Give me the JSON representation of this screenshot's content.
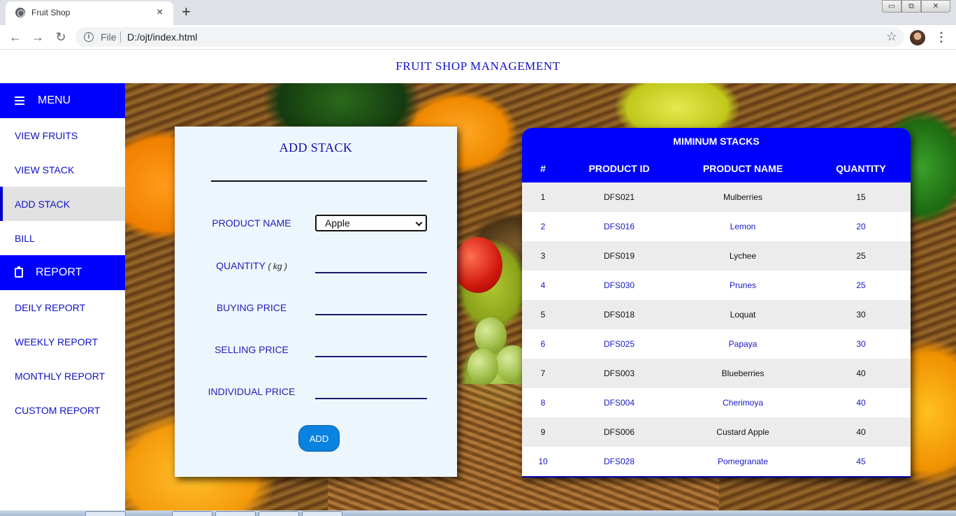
{
  "browser": {
    "tab_title": "Fruit Shop",
    "tab_close": "×",
    "new_tab": "+",
    "scheme_label": "File",
    "url": "D:/ojt/index.html",
    "back": "←",
    "forward": "→",
    "reload": "↻",
    "star": "☆",
    "menu": "⋮",
    "win_min": "▭",
    "win_restore": "⧉",
    "win_close": "✕"
  },
  "page": {
    "title": "FRUIT SHOP MANAGEMENT"
  },
  "sidebar": {
    "menu_label": "MENU",
    "items": [
      {
        "label": "VIEW FRUITS"
      },
      {
        "label": "VIEW STACK"
      },
      {
        "label": "ADD STACK",
        "active": true
      },
      {
        "label": "BILL"
      }
    ],
    "report_label": "REPORT",
    "report_items": [
      {
        "label": "DEILY REPORT"
      },
      {
        "label": "WEEKLY REPORT"
      },
      {
        "label": "MONTHLY REPORT"
      },
      {
        "label": "CUSTOM REPORT"
      }
    ]
  },
  "form": {
    "title": "ADD STACK",
    "product_name_label": "PRODUCT NAME",
    "product_selected": "Apple",
    "quantity_label": "QUANTITY",
    "quantity_unit": "( kg )",
    "buying_price_label": "BUYING PRICE",
    "selling_price_label": "SELLING PRICE",
    "individual_price_label": "INDIVIDUAL PRICE",
    "add_button": "ADD"
  },
  "table": {
    "caption": "MIMINUM STACKS",
    "columns": [
      "#",
      "PRODUCT ID",
      "PRODUCT NAME",
      "QUANTITY"
    ],
    "rows": [
      [
        "1",
        "DFS021",
        "Mulberries",
        "15"
      ],
      [
        "2",
        "DFS016",
        "Lemon",
        "20"
      ],
      [
        "3",
        "DFS019",
        "Lychee",
        "25"
      ],
      [
        "4",
        "DFS030",
        "Prunes",
        "25"
      ],
      [
        "5",
        "DFS018",
        "Loquat",
        "30"
      ],
      [
        "6",
        "DFS025",
        "Papaya",
        "30"
      ],
      [
        "7",
        "DFS003",
        "Blueberries",
        "40"
      ],
      [
        "8",
        "DFS004",
        "Cherimoya",
        "40"
      ],
      [
        "9",
        "DFS006",
        "Custard Apple",
        "40"
      ],
      [
        "10",
        "DFS028",
        "Pomegranate",
        "45"
      ]
    ]
  },
  "colors": {
    "accent_blue": "#0000ff",
    "link_blue": "#1010c8",
    "button_blue": "#0a82e0"
  }
}
